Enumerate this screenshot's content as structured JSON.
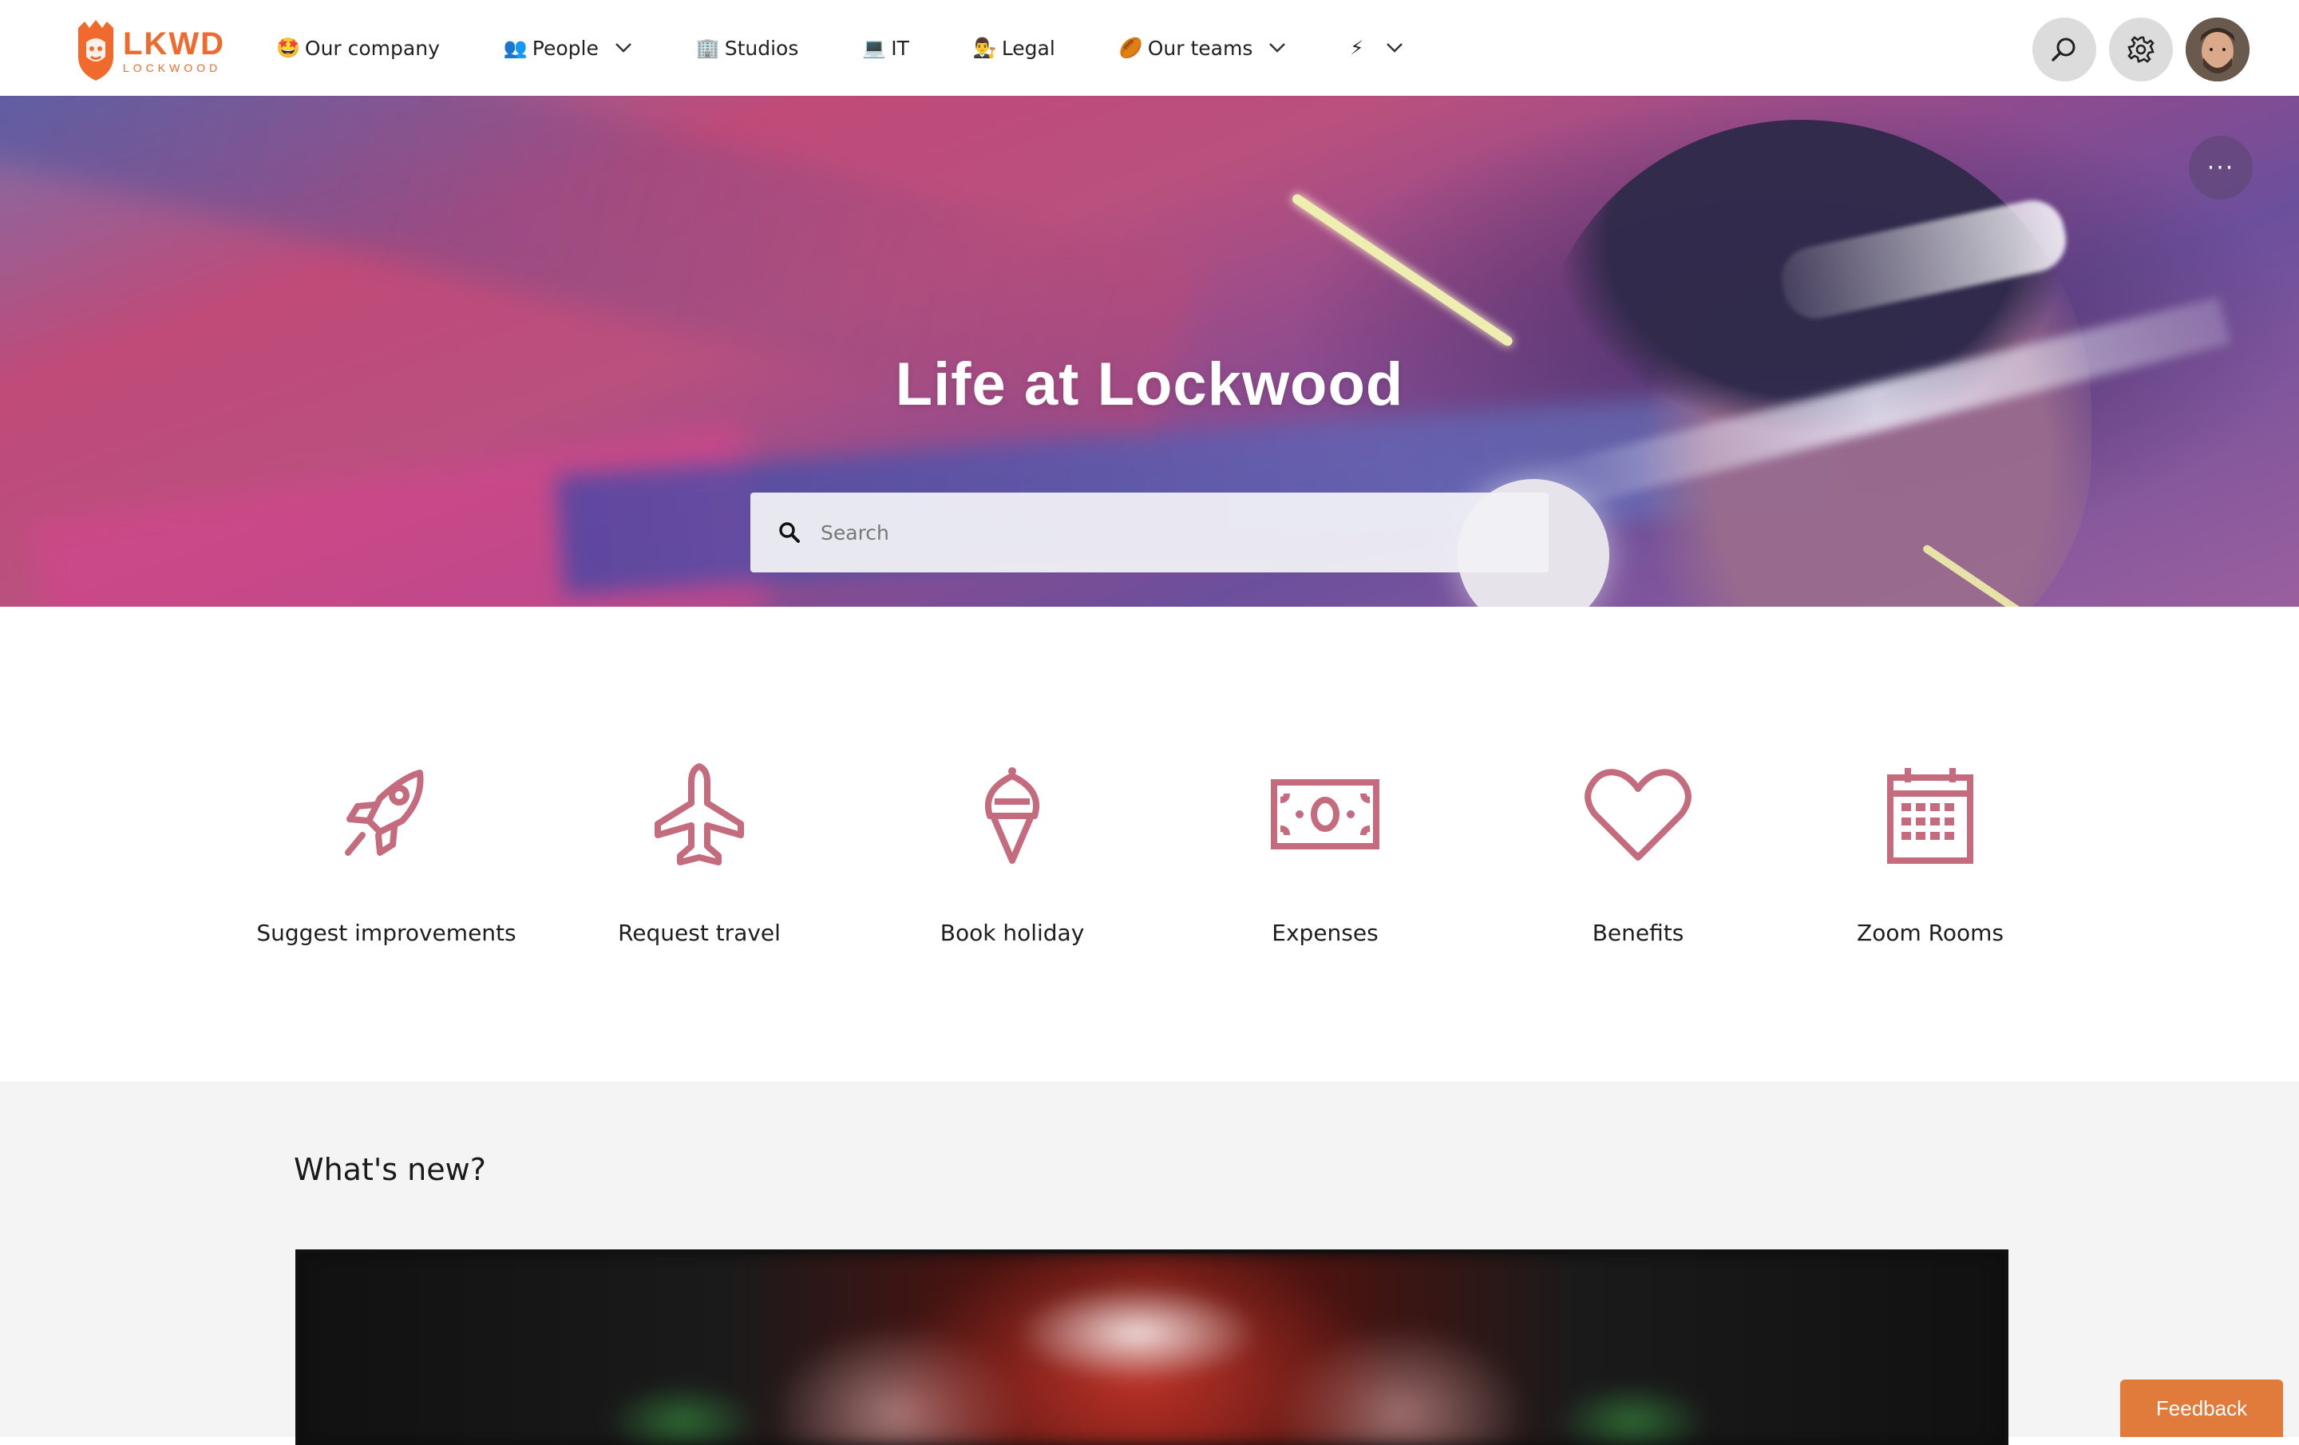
{
  "brand": {
    "logo_main": "LKWD",
    "logo_sub": "LOCKWOOD",
    "accent_color": "#f16a2d"
  },
  "nav": {
    "items": [
      {
        "emoji": "🤩",
        "label": "Our company",
        "has_dropdown": false
      },
      {
        "emoji": "👥",
        "label": "People",
        "has_dropdown": true
      },
      {
        "emoji": "🏢",
        "label": "Studios",
        "has_dropdown": false
      },
      {
        "emoji": "💻",
        "label": "IT",
        "has_dropdown": false
      },
      {
        "emoji": "👨‍⚖️",
        "label": "Legal",
        "has_dropdown": false
      },
      {
        "emoji": "🏉",
        "label": "Our teams",
        "has_dropdown": true
      },
      {
        "emoji": "⚡",
        "label": "",
        "has_dropdown": true
      }
    ],
    "right_icons": [
      "search-icon",
      "gear-icon",
      "avatar"
    ]
  },
  "hero": {
    "title": "Life at Lockwood",
    "search_placeholder": "Search",
    "more_label": "···"
  },
  "quick_links": {
    "icon_color": "#c46b7e",
    "items": [
      {
        "icon": "rocket-icon",
        "label": "Suggest improvements"
      },
      {
        "icon": "airplane-icon",
        "label": "Request travel"
      },
      {
        "icon": "ice-cream-icon",
        "label": "Book holiday"
      },
      {
        "icon": "money-icon",
        "label": "Expenses"
      },
      {
        "icon": "heart-icon",
        "label": "Benefits"
      },
      {
        "icon": "calendar-icon",
        "label": "Zoom Rooms"
      }
    ]
  },
  "whats_new": {
    "title": "What's new?"
  },
  "feedback": {
    "label": "Feedback",
    "color": "#e07b3c"
  }
}
